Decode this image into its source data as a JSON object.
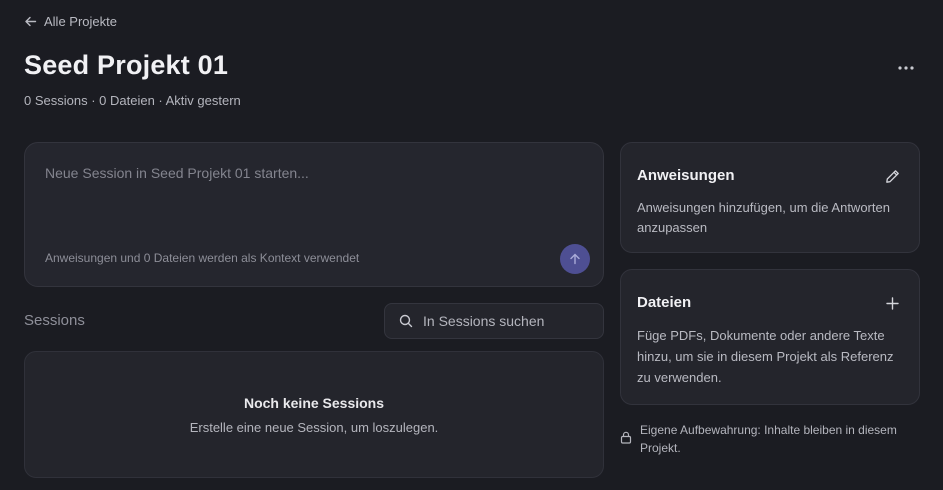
{
  "nav": {
    "back_label": "Alle Projekte"
  },
  "project": {
    "title": "Seed Projekt 01",
    "meta": "0 Sessions · 0 Dateien · Aktiv gestern"
  },
  "composer": {
    "placeholder": "Neue Session in Seed Projekt 01 starten...",
    "value": "",
    "context_hint": "Anweisungen und 0 Dateien werden als Kontext verwendet"
  },
  "sessions": {
    "heading": "Sessions",
    "search_placeholder": "In Sessions suchen",
    "search_value": "",
    "empty_title": "Noch keine Sessions",
    "empty_subtitle": "Erstelle eine neue Session, um loszulegen."
  },
  "instructions_card": {
    "title": "Anweisungen",
    "body": "Anweisungen hinzufügen, um die Antworten anzupassen",
    "action_icon": "pencil-icon"
  },
  "files_card": {
    "title": "Dateien",
    "body": "Füge PDFs, Dokumente oder andere Texte hinzu, um sie in diesem Projekt als Referenz zu verwenden.",
    "action_icon": "plus-icon"
  },
  "storage_note": {
    "text": "Eigene Aufbewahrung: Inhalte bleiben in diesem Projekt.",
    "icon": "lock-icon"
  },
  "colors": {
    "background": "#1b1c22",
    "card": "#24252c",
    "accent": "#4e4f93",
    "text_primary": "#f1f1f4",
    "text_muted": "#b4b5bd"
  }
}
